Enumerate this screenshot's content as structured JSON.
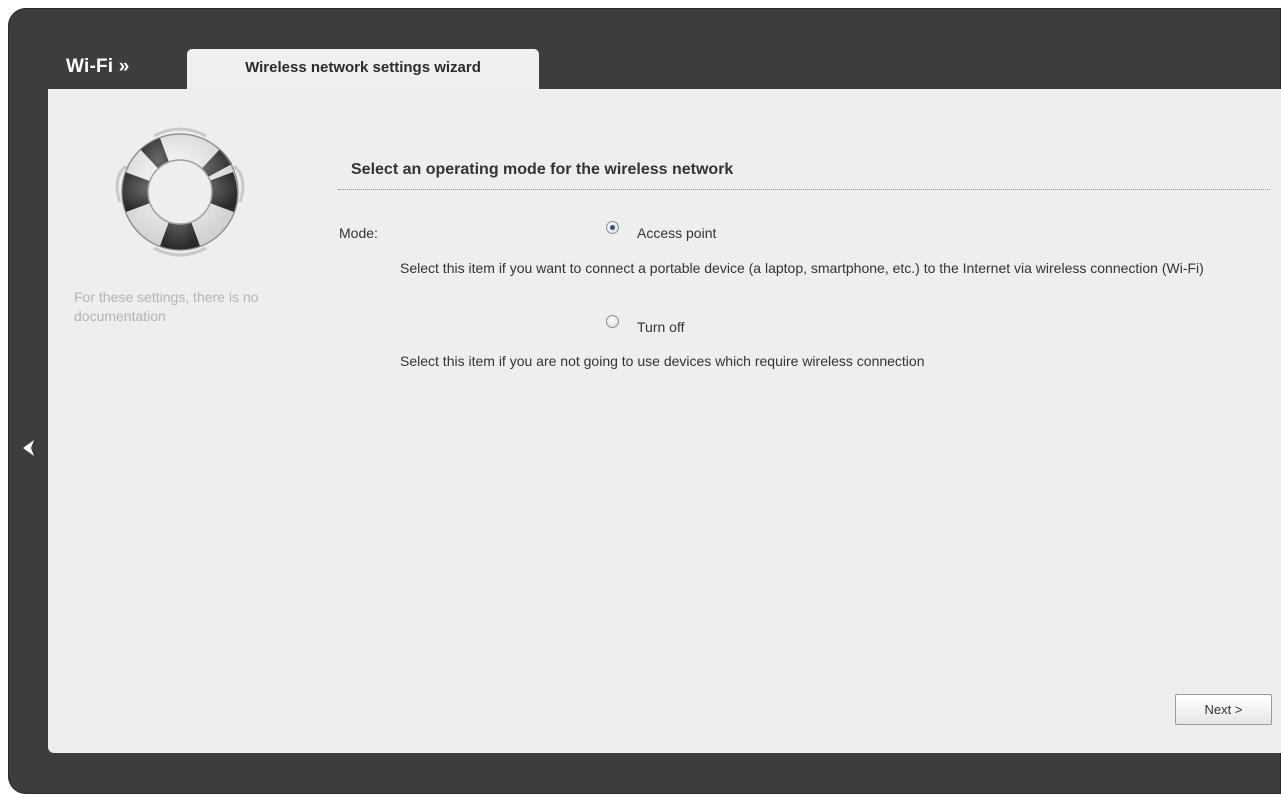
{
  "header": {
    "section_title": "Wi-Fi »",
    "tab_label": "Wireless network settings wizard"
  },
  "sidebar": {
    "help_text": "For these settings, there is no documentation",
    "icon": "lifebuoy-icon"
  },
  "main": {
    "heading": "Select an operating mode for the wireless network",
    "mode_label": "Mode:",
    "options": [
      {
        "label": "Access point",
        "checked": true,
        "description": "Select this item if you want to connect a portable device (a laptop, smartphone, etc.) to the Internet via wireless connection (Wi-Fi)"
      },
      {
        "label": "Turn off",
        "checked": false,
        "description": "Select this item if you are not going to use devices which require wireless connection"
      }
    ]
  },
  "navigation": {
    "back_icon": "chevron-left-icon",
    "next_label": "Next >"
  },
  "colors": {
    "frame": "#3d3d3d",
    "panel": "#eeeeee",
    "radio_selected": "#2b4f9a"
  }
}
